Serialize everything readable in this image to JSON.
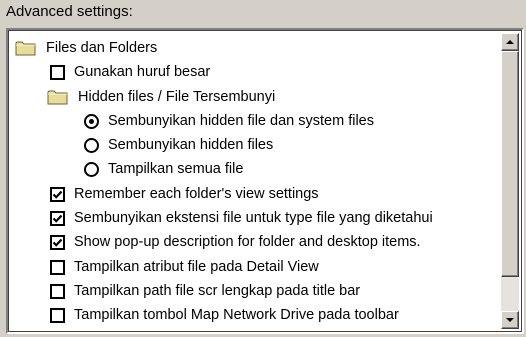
{
  "group_label": "Advanced settings:",
  "items": [
    {
      "type": "folder",
      "label": "Files dan Folders"
    },
    {
      "type": "checkbox",
      "checked": false,
      "label": "Gunakan huruf besar"
    },
    {
      "type": "folder",
      "label": "Hidden files / File Tersembunyi"
    },
    {
      "type": "radio",
      "selected": true,
      "label": "Sembunyikan hidden file dan system files"
    },
    {
      "type": "radio",
      "selected": false,
      "label": "Sembunyikan hidden files"
    },
    {
      "type": "radio",
      "selected": false,
      "label": "Tampilkan semua file"
    },
    {
      "type": "checkbox",
      "checked": true,
      "label": "Remember each folder's view settings"
    },
    {
      "type": "checkbox",
      "checked": true,
      "label": "Sembunyikan ekstensi file untuk type file yang diketahui"
    },
    {
      "type": "checkbox",
      "checked": true,
      "label": "Show pop-up description for folder and desktop items."
    },
    {
      "type": "checkbox",
      "checked": false,
      "label": "Tampilkan atribut file pada Detail View"
    },
    {
      "type": "checkbox",
      "checked": false,
      "label": "Tampilkan path file scr lengkap pada title bar"
    },
    {
      "type": "checkbox",
      "checked": false,
      "label": "Tampilkan tombol Map Network Drive pada toolbar"
    }
  ],
  "icons": {
    "folder": "folder-icon",
    "checkbox": "checkbox",
    "radio": "radio-button",
    "scroll_up": "scroll-up-arrow-icon",
    "scroll_down": "scroll-down-arrow-icon"
  },
  "colors": {
    "dialog_bg": "#d4d0c8",
    "list_bg": "#ffffff",
    "folder_fill": "#e8dc9a",
    "folder_stroke": "#6b6438"
  }
}
